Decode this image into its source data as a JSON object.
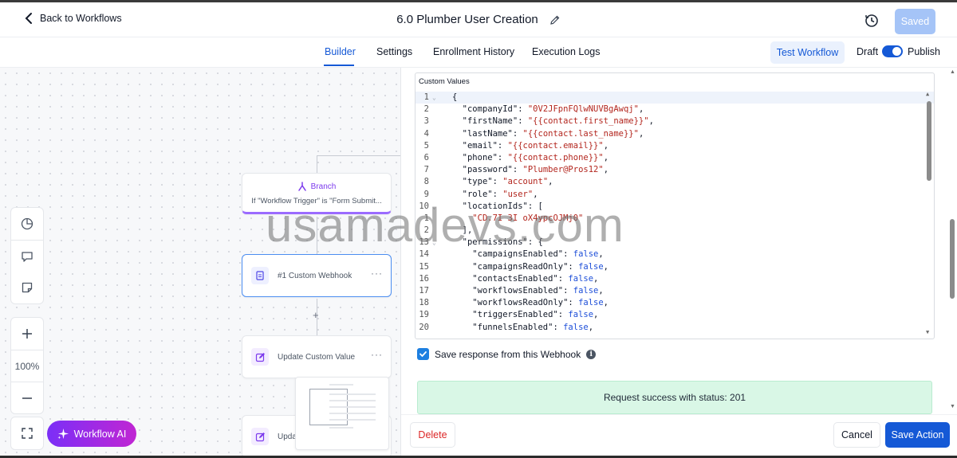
{
  "header": {
    "back_label": "Back to Workflows",
    "title": "6.0 Plumber User Creation",
    "saved_label": "Saved"
  },
  "tabs": [
    {
      "label": "Builder",
      "active": true
    },
    {
      "label": "Settings",
      "active": false
    },
    {
      "label": "Enrollment History",
      "active": false
    },
    {
      "label": "Execution Logs",
      "active": false
    }
  ],
  "toolbar": {
    "test_label": "Test Workflow",
    "draft_label": "Draft",
    "publish_label": "Publish",
    "publish_toggle_on": true
  },
  "canvas": {
    "branch": {
      "label": "Branch",
      "condition": "If \"Workflow Trigger\" is \"Form Submit..."
    },
    "nodes": [
      {
        "label": "#1 Custom Webhook",
        "icon": "webhook-icon",
        "selected": true
      },
      {
        "label": "Update Custom Value",
        "icon": "edit-icon"
      },
      {
        "label": "Upda",
        "icon": "edit-icon"
      }
    ],
    "zoom": "100%",
    "ai_label": "Workflow AI"
  },
  "panel": {
    "editor_label": "Custom Values",
    "code_lines": [
      {
        "n": "1",
        "fold": true
      },
      {
        "n": "2",
        "fold": false
      },
      {
        "n": "3",
        "fold": false
      },
      {
        "n": "4",
        "fold": false
      },
      {
        "n": "5",
        "fold": false
      },
      {
        "n": "6",
        "fold": false
      },
      {
        "n": "7",
        "fold": false
      },
      {
        "n": "8",
        "fold": false
      },
      {
        "n": "9",
        "fold": false
      },
      {
        "n": "10",
        "fold": true
      },
      {
        "n": "1",
        "fold": false
      },
      {
        "n": "2",
        "fold": false
      },
      {
        "n": "13",
        "fold": true
      },
      {
        "n": "14",
        "fold": false
      },
      {
        "n": "15",
        "fold": false
      },
      {
        "n": "16",
        "fold": false
      },
      {
        "n": "17",
        "fold": false
      },
      {
        "n": "18",
        "fold": false
      },
      {
        "n": "19",
        "fold": false
      },
      {
        "n": "20",
        "fold": false
      }
    ],
    "code": {
      "l1": "{",
      "companyId_key": "\"companyId\"",
      "companyId_val": "\"0V2JFpnFQlwNUVBgAwqj\"",
      "firstName_key": "\"firstName\"",
      "firstName_val": "\"{{contact.first_name}}\"",
      "lastName_key": "\"lastName\"",
      "lastName_val": "\"{{contact.last_name}}\"",
      "email_key": "\"email\"",
      "email_val": "\"{{contact.email}}\"",
      "phone_key": "\"phone\"",
      "phone_val": "\"{{contact.phone}}\"",
      "password_key": "\"password\"",
      "password_val": "\"Plumber@Pros12\"",
      "type_key": "\"type\"",
      "type_val": "\"account\"",
      "role_key": "\"role\"",
      "role_val": "\"user\"",
      "locationIds_key": "\"locationIds\"",
      "locationIds_open": "[",
      "location_val": "\"CD.7I 3I oX4ypcOJMj0\"",
      "close_bracket": "],",
      "permissions_key": "\"permissions\"",
      "permissions_open": "{",
      "campaignsEnabled_key": "\"campaignsEnabled\"",
      "campaignsReadOnly_key": "\"campaignsReadOnly\"",
      "contactsEnabled_key": "\"contactsEnabled\"",
      "workflowsEnabled_key": "\"workflowsEnabled\"",
      "workflowsReadOnly_key": "\"workflowsReadOnly\"",
      "triggersEnabled_key": "\"triggersEnabled\"",
      "funnelsEnabled_key": "\"funnelsEnabled\"",
      "false_val": "false"
    },
    "save_response_label": "Save response from this Webhook",
    "save_response_checked": true,
    "success_message": "Request success with status: 201",
    "delete_label": "Delete",
    "cancel_label": "Cancel",
    "save_label": "Save Action"
  },
  "watermark": "usamadevs.com",
  "colors": {
    "accent": "#1559d6",
    "branch": "#7c3aed",
    "success_bg": "#d9f7e6",
    "danger": "#dc2626"
  }
}
